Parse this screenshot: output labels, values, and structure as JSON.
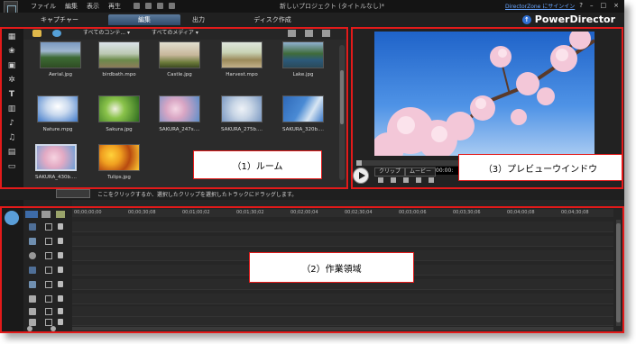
{
  "colors": {
    "annotation_red": "#e31a1a",
    "dark_bg": "#1b1b1b",
    "tab_active": "#3f5f82",
    "link_blue": "#6aa6ff"
  },
  "menu": [
    "ファイル",
    "編集",
    "表示",
    "再生"
  ],
  "window_title": "新しいプロジェクト (タイトルなし)*",
  "directorzone_link": "DirectorZone にサインイン",
  "window_buttons": [
    "?",
    "–",
    "□",
    "×"
  ],
  "tabs": [
    {
      "label": "キャプチャー",
      "active": false
    },
    {
      "label": "編集",
      "active": true
    },
    {
      "label": "出力",
      "active": false
    },
    {
      "label": "ディスク作成",
      "active": false
    }
  ],
  "brand": "PowerDirector",
  "room": {
    "filter_content": "すべてのコンテ...",
    "filter_media": "すべてのメディア",
    "media": [
      {
        "label": "Aerial.jpg",
        "icon": "landscape"
      },
      {
        "label": "birdbath.mpo",
        "icon": "garden"
      },
      {
        "label": "Castle.jpg",
        "icon": "castle"
      },
      {
        "label": "Harvest.mpo",
        "icon": "harvest"
      },
      {
        "label": "Lake.jpg",
        "icon": "lake"
      },
      {
        "label": "Nature.mpg",
        "icon": "clouds"
      },
      {
        "label": "Sakura.jpg",
        "icon": "flowers"
      },
      {
        "label": "SAKURA_247s....",
        "icon": "sakura"
      },
      {
        "label": "SAKURA_275b....",
        "icon": "sakura"
      },
      {
        "label": "SAKURA_320b....",
        "icon": "sakura"
      },
      {
        "label": "SAKURA_430b....",
        "icon": "sakura"
      },
      {
        "label": "Tulips.jpg",
        "icon": "tulips"
      }
    ]
  },
  "preview": {
    "mode_clip": "クリップ",
    "mode_movie": "ムービー",
    "timecode": "00:00:",
    "image": "cherry-blossom-sky"
  },
  "instruction": "ここをクリックするか、選択したクリップを選択したトラックにドラッグします。",
  "timeline": {
    "ruler": [
      "00;00;00;00",
      "00;00;30;08",
      "00;01;00;02",
      "00;01;30;02",
      "00;02;00;04",
      "00;02;30;04",
      "00;03;00;06",
      "00;03;30;06",
      "00;04;00;08",
      "00;04;30;08"
    ],
    "tracks": [
      "1. video",
      "1. audio",
      "fx",
      "2. video",
      "2. audio",
      "title",
      "voice",
      "music"
    ]
  },
  "annotations": {
    "room": "（1）ルーム",
    "work_area": "（2）作業領域",
    "preview_window": "（3）プレビューウインドウ"
  }
}
